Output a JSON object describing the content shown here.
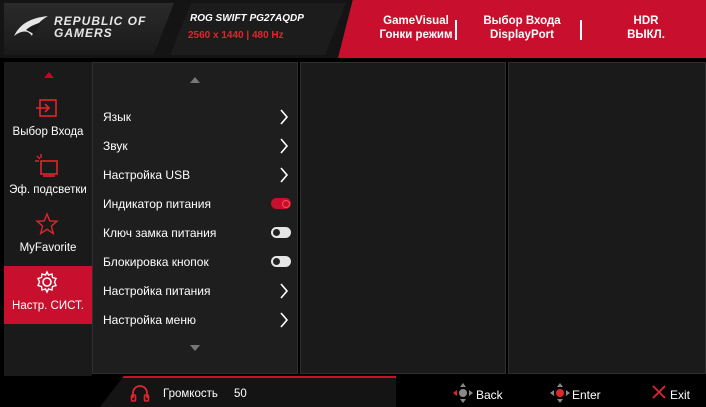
{
  "header": {
    "brand_line1": "REPUBLIC OF",
    "brand_line2": "GAMERS",
    "model_series": "ROG SWIFT",
    "model_number": "PG27AQDP",
    "model_spec": "2560 x 1440  |  480 Hz",
    "status": [
      {
        "line1": "GameVisual",
        "line2": "Гонки режим"
      },
      {
        "line1": "Выбор Входа",
        "line2": "DisplayPort"
      },
      {
        "line1": "HDR",
        "line2": "ВЫКЛ."
      }
    ]
  },
  "nav": {
    "items": [
      {
        "label": "Выбор Входа",
        "icon": "input-icon"
      },
      {
        "label": "Эф. подсветки",
        "icon": "light-effect-icon"
      },
      {
        "label": "MyFavorite",
        "icon": "star-icon"
      },
      {
        "label": "Настр. СИСТ.",
        "icon": "gear-icon"
      }
    ],
    "active_index": 3
  },
  "menu": {
    "items": [
      {
        "label": "Язык",
        "type": "submenu"
      },
      {
        "label": "Звук",
        "type": "submenu"
      },
      {
        "label": "Настройка USB",
        "type": "submenu"
      },
      {
        "label": "Индикатор питания",
        "type": "toggle",
        "on": true
      },
      {
        "label": "Ключ замка питания",
        "type": "toggle",
        "on": false
      },
      {
        "label": "Блокировка кнопок",
        "type": "toggle",
        "on": false
      },
      {
        "label": "Настройка питания",
        "type": "submenu"
      },
      {
        "label": "Настройка меню",
        "type": "submenu"
      }
    ]
  },
  "footer": {
    "volume_label": "Громкость",
    "volume_value": "50",
    "back_label": "Back",
    "enter_label": "Enter",
    "exit_label": "Exit"
  },
  "colors": {
    "accent": "#c8102e",
    "panel": "#1a1a1a",
    "background": "#000000"
  }
}
